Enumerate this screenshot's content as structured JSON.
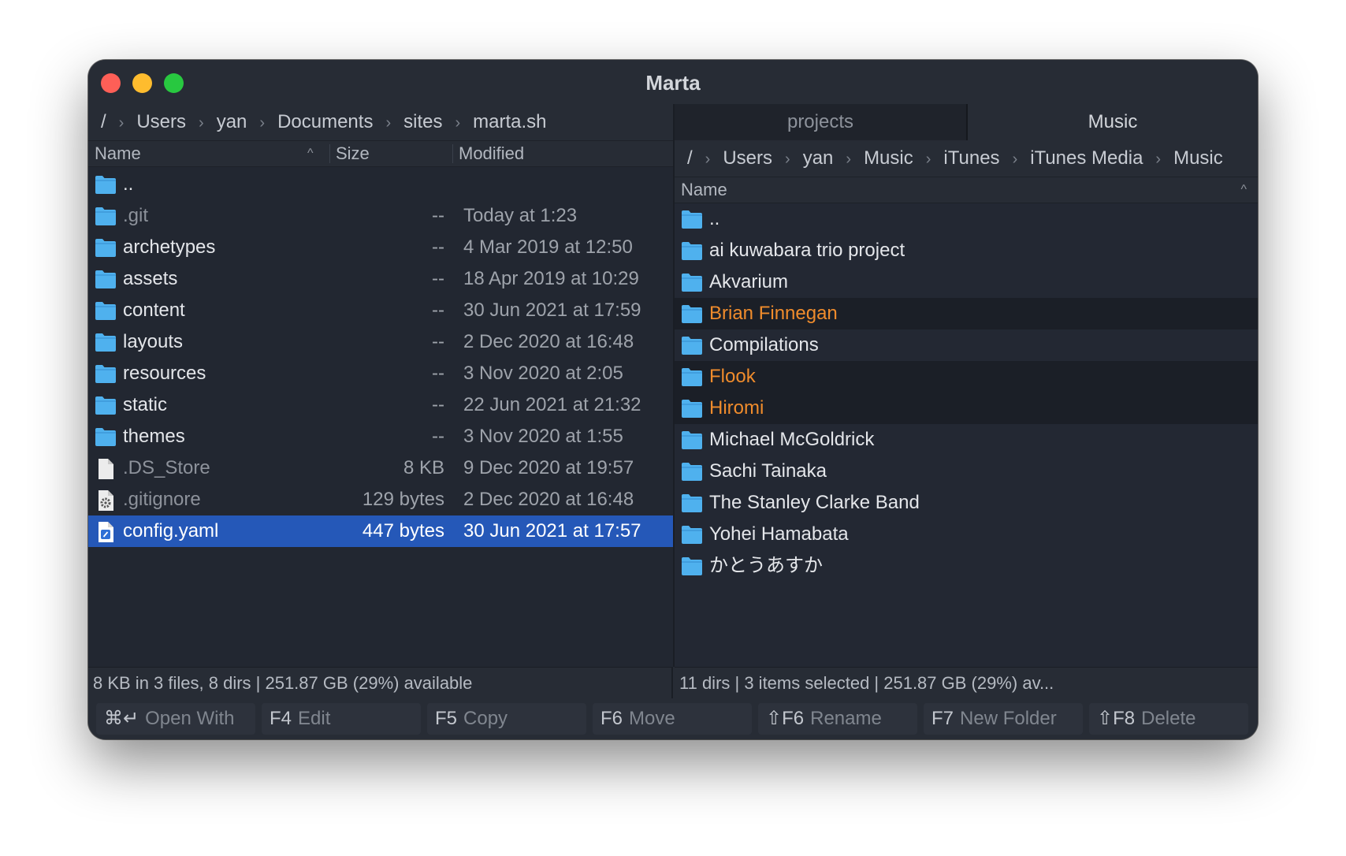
{
  "window": {
    "title": "Marta"
  },
  "left": {
    "breadcrumb": [
      "/",
      "Users",
      "yan",
      "Documents",
      "sites",
      "marta.sh"
    ],
    "columns": {
      "name": "Name",
      "size": "Size",
      "modified": "Modified"
    },
    "rows": [
      {
        "name": "..",
        "size": "",
        "modified": "",
        "icon": "folder-icon",
        "style": ""
      },
      {
        "name": ".git",
        "size": "--",
        "modified": "Today at 1:23",
        "icon": "folder-icon",
        "style": "dim"
      },
      {
        "name": "archetypes",
        "size": "--",
        "modified": "4 Mar 2019 at 12:50",
        "icon": "folder-icon",
        "style": ""
      },
      {
        "name": "assets",
        "size": "--",
        "modified": "18 Apr 2019 at 10:29",
        "icon": "folder-icon",
        "style": ""
      },
      {
        "name": "content",
        "size": "--",
        "modified": "30 Jun 2021 at 17:59",
        "icon": "folder-icon",
        "style": ""
      },
      {
        "name": "layouts",
        "size": "--",
        "modified": "2 Dec 2020 at 16:48",
        "icon": "folder-icon",
        "style": ""
      },
      {
        "name": "resources",
        "size": "--",
        "modified": "3 Nov 2020 at 2:05",
        "icon": "folder-icon",
        "style": ""
      },
      {
        "name": "static",
        "size": "--",
        "modified": "22 Jun 2021 at 21:32",
        "icon": "folder-icon",
        "style": ""
      },
      {
        "name": "themes",
        "size": "--",
        "modified": "3 Nov 2020 at 1:55",
        "icon": "folder-icon",
        "style": ""
      },
      {
        "name": ".DS_Store",
        "size": "8 KB",
        "modified": "9 Dec 2020 at 19:57",
        "icon": "file-icon",
        "style": "dim"
      },
      {
        "name": ".gitignore",
        "size": "129 bytes",
        "modified": "2 Dec 2020 at 16:48",
        "icon": "settings-file-icon",
        "style": "dim"
      },
      {
        "name": "config.yaml",
        "size": "447 bytes",
        "modified": "30 Jun 2021 at 17:57",
        "icon": "yaml-file-icon",
        "style": "sel"
      }
    ],
    "status": "8 KB in 3 files, 8 dirs  |  251.87 GB (29%) available"
  },
  "right": {
    "tabs": [
      "projects",
      "Music"
    ],
    "breadcrumb": [
      "/",
      "Users",
      "yan",
      "Music",
      "iTunes",
      "iTunes Media",
      "Music"
    ],
    "columns": {
      "name": "Name"
    },
    "rows": [
      {
        "name": "..",
        "icon": "folder-icon",
        "style": ""
      },
      {
        "name": "ai kuwabara trio project",
        "icon": "folder-icon",
        "style": ""
      },
      {
        "name": "Akvarium",
        "icon": "folder-icon",
        "style": ""
      },
      {
        "name": "Brian Finnegan",
        "icon": "folder-icon",
        "style": "mark"
      },
      {
        "name": "Compilations",
        "icon": "folder-icon",
        "style": ""
      },
      {
        "name": "Flook",
        "icon": "folder-icon",
        "style": "mark"
      },
      {
        "name": "Hiromi",
        "icon": "folder-icon",
        "style": "mark"
      },
      {
        "name": "Michael McGoldrick",
        "icon": "folder-icon",
        "style": ""
      },
      {
        "name": "Sachi Tainaka",
        "icon": "folder-icon",
        "style": ""
      },
      {
        "name": "The Stanley Clarke Band",
        "icon": "folder-icon",
        "style": ""
      },
      {
        "name": "Yohei Hamabata",
        "icon": "folder-icon",
        "style": ""
      },
      {
        "name": "かとうあすか",
        "icon": "folder-icon",
        "style": ""
      }
    ],
    "status": "11 dirs  |  3 items selected  |  251.87 GB (29%) av..."
  },
  "function_keys": [
    {
      "key": "⌘↵",
      "label": "Open With"
    },
    {
      "key": "F4",
      "label": "Edit"
    },
    {
      "key": "F5",
      "label": "Copy"
    },
    {
      "key": "F6",
      "label": "Move"
    },
    {
      "key": "⇧F6",
      "label": "Rename"
    },
    {
      "key": "F7",
      "label": "New Folder"
    },
    {
      "key": "⇧F8",
      "label": "Delete"
    }
  ],
  "colors": {
    "selection": "#2558b8",
    "marked_text": "#f08c2c",
    "folder": "#4fb1ee",
    "close": "#fe5f57",
    "minimize": "#febc2e",
    "zoom": "#28c840"
  }
}
